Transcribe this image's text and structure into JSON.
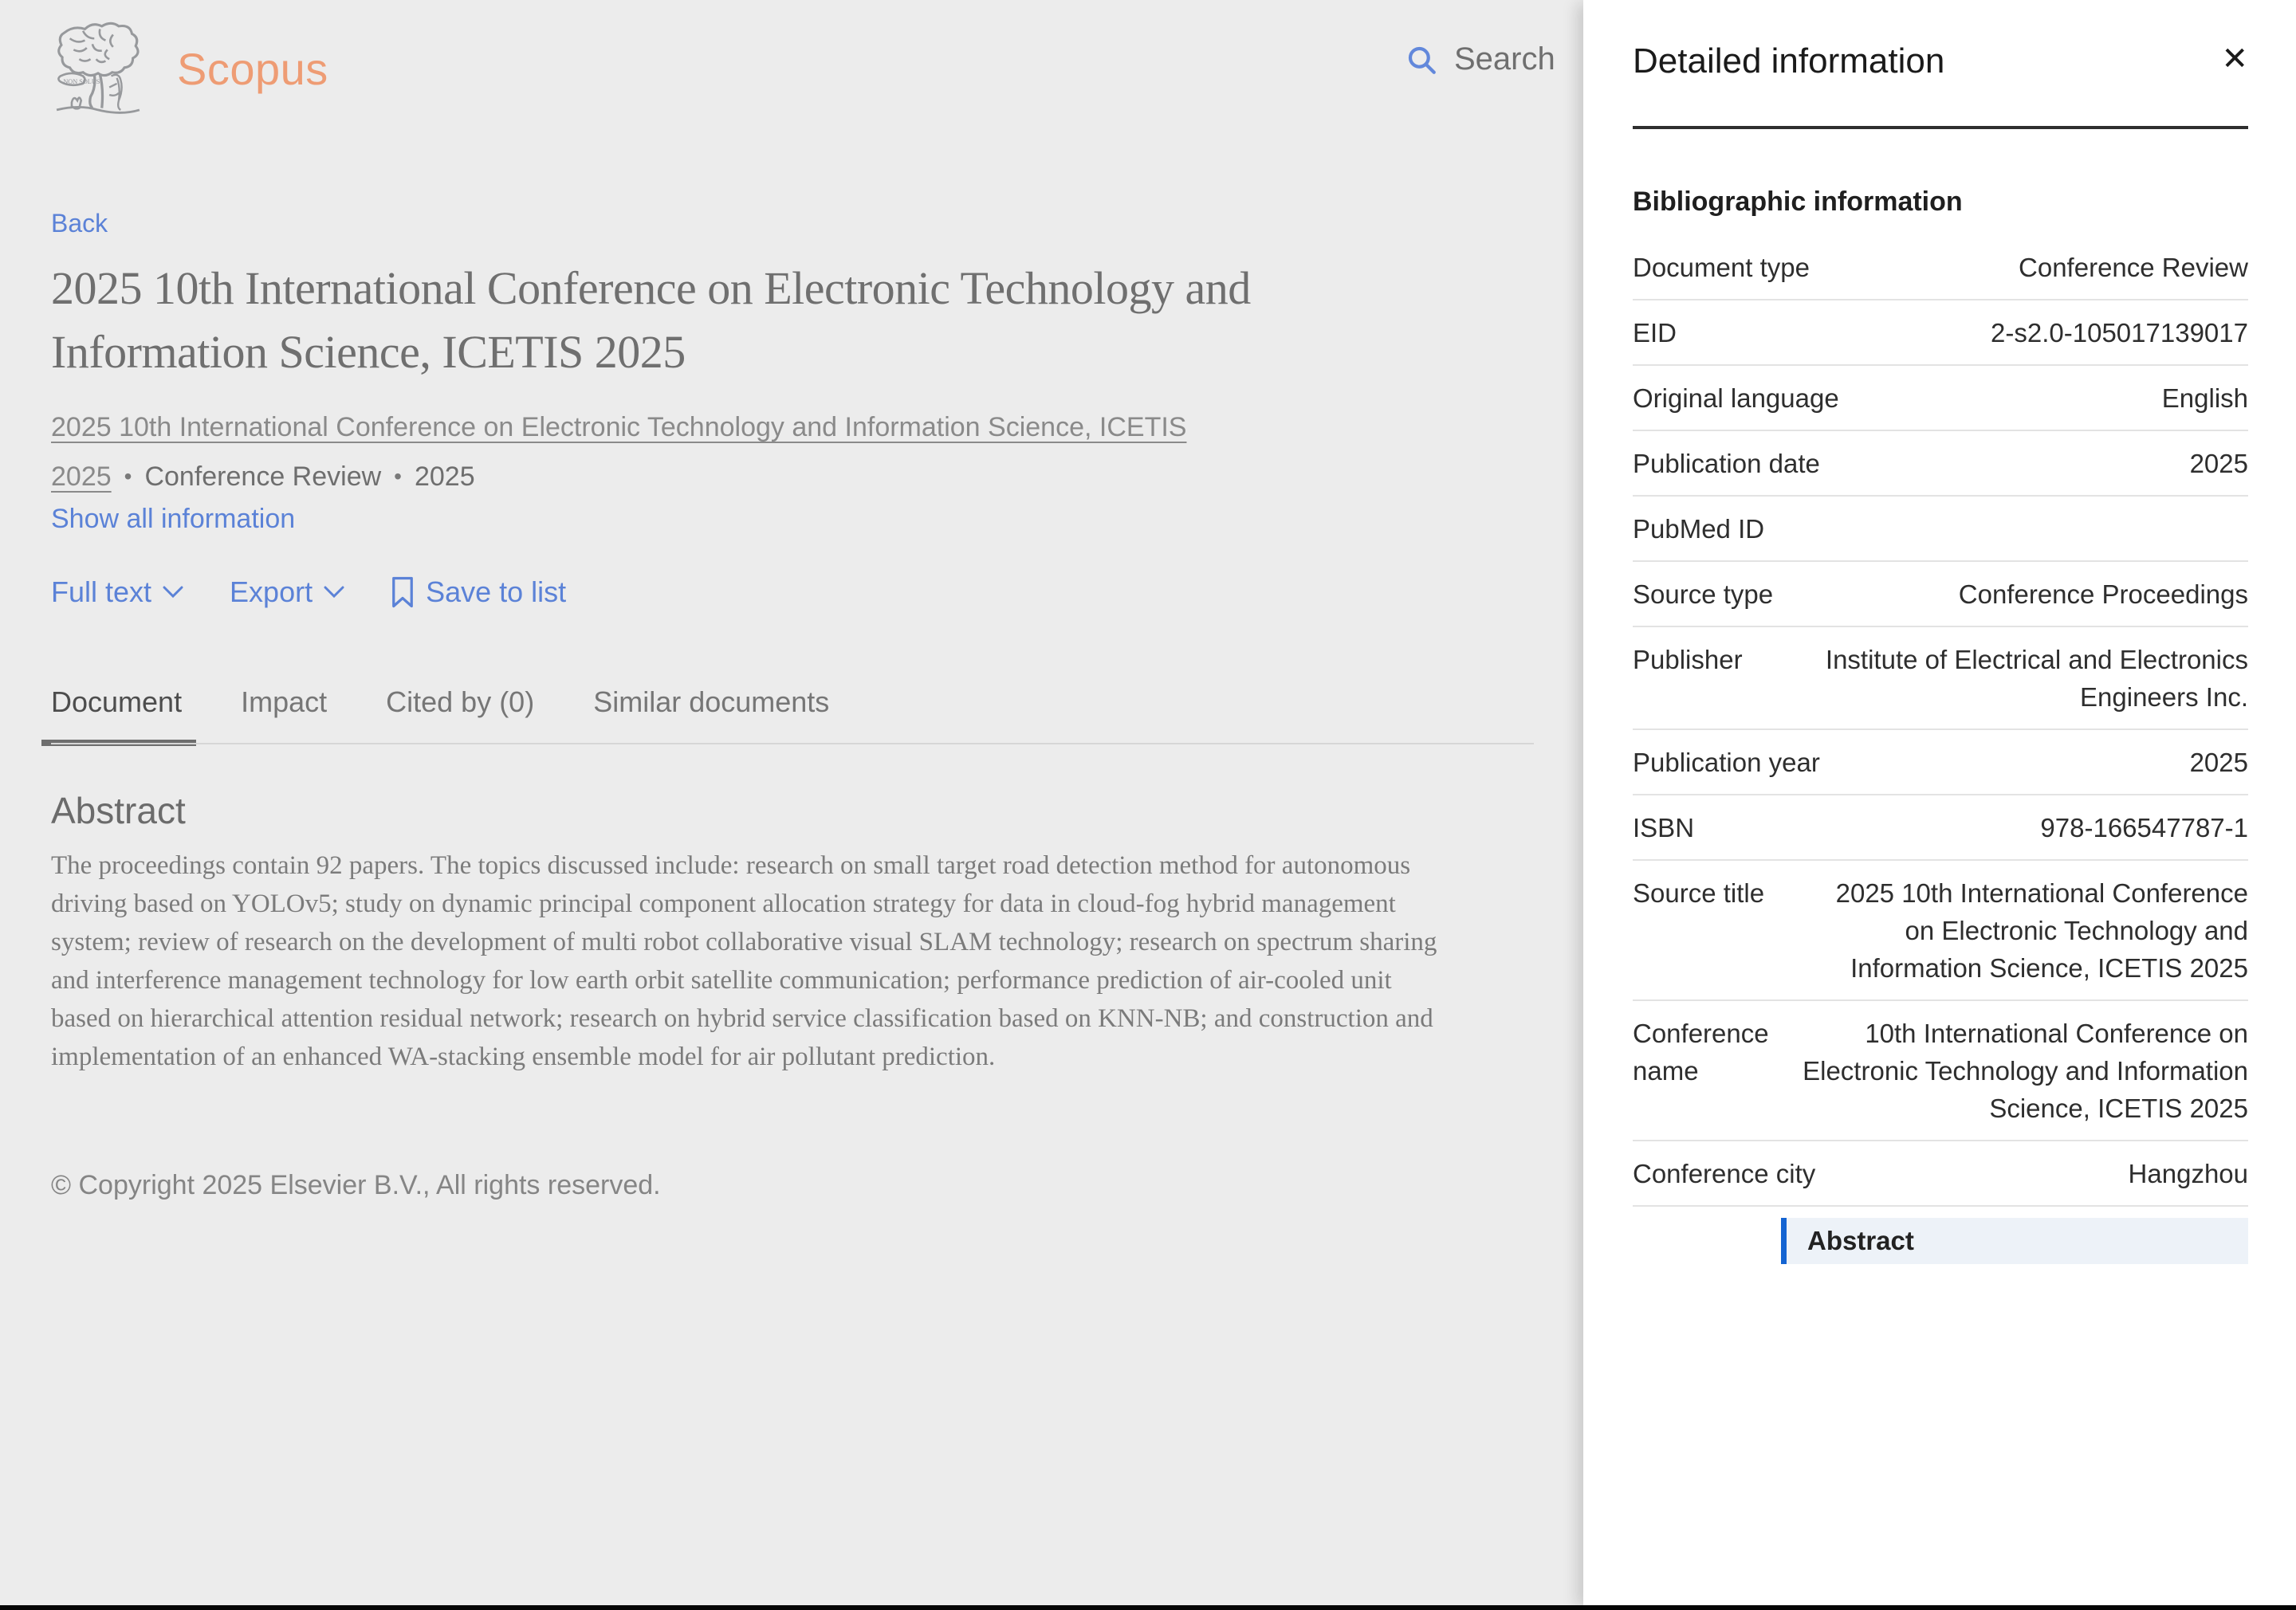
{
  "header": {
    "brand": "Scopus",
    "search_label": "Search"
  },
  "main": {
    "back_label": "Back",
    "title": "2025 10th International Conference on Electronic Technology and Information Science, ICETIS 2025",
    "source_link": "2025 10th International Conference on Electronic Technology and Information Science, ICETIS 2025",
    "separator": "•",
    "doc_type": "Conference Review",
    "year": "2025",
    "show_all_label": "Show all information",
    "actions": {
      "full_text": "Full text",
      "export": "Export",
      "save_to_list": "Save to list"
    },
    "tabs": [
      {
        "label": "Document",
        "active": true
      },
      {
        "label": "Impact",
        "active": false
      },
      {
        "label": "Cited by (0)",
        "active": false
      },
      {
        "label": "Similar documents",
        "active": false
      }
    ],
    "abstract_heading": "Abstract",
    "abstract_text": "The proceedings contain 92 papers. The topics discussed include: research on small target road detection method for autonomous driving based on YOLOv5; study on dynamic principal component allocation strategy for data in cloud-fog hybrid management system; review of research on the development of multi robot collaborative visual SLAM technology; research on spectrum sharing and interference management technology for low earth orbit satellite communication; performance prediction of air-cooled unit based on hierarchical attention residual network; research on hybrid service classification based on KNN-NB; and construction and implementation of an enhanced WA-stacking ensemble model for air pollutant prediction.",
    "copyright": "© Copyright 2025 Elsevier B.V., All rights reserved."
  },
  "panel": {
    "title": "Detailed information",
    "close_glyph": "✕",
    "section_heading": "Bibliographic information",
    "rows": [
      {
        "label": "Document type",
        "value": "Conference Review"
      },
      {
        "label": "EID",
        "value": "2-s2.0-105017139017"
      },
      {
        "label": "Original language",
        "value": "English"
      },
      {
        "label": "Publication date",
        "value": "2025"
      },
      {
        "label": "PubMed ID",
        "value": ""
      },
      {
        "label": "Source type",
        "value": "Conference Proceedings"
      },
      {
        "label": "Publisher",
        "value": "Institute of Electrical and Electronics Engineers Inc."
      },
      {
        "label": "Publication year",
        "value": "2025"
      },
      {
        "label": "ISBN",
        "value": "978-166547787-1"
      },
      {
        "label": "Source title",
        "value": "2025 10th International Conference on Electronic Technology and Information Science, ICETIS 2025"
      },
      {
        "label": "Conference name",
        "value": "10th International Conference on Electronic Technology and Information Science, ICETIS 2025"
      },
      {
        "label": "Conference city",
        "value": "Hangzhou"
      }
    ],
    "nav_item": "Abstract"
  },
  "colors": {
    "link_blue": "#5b82d7",
    "brand_orange": "#ee9c74",
    "nav_accent_blue": "#1464d2",
    "main_background": "#ececec",
    "panel_background": "#ffffff"
  }
}
